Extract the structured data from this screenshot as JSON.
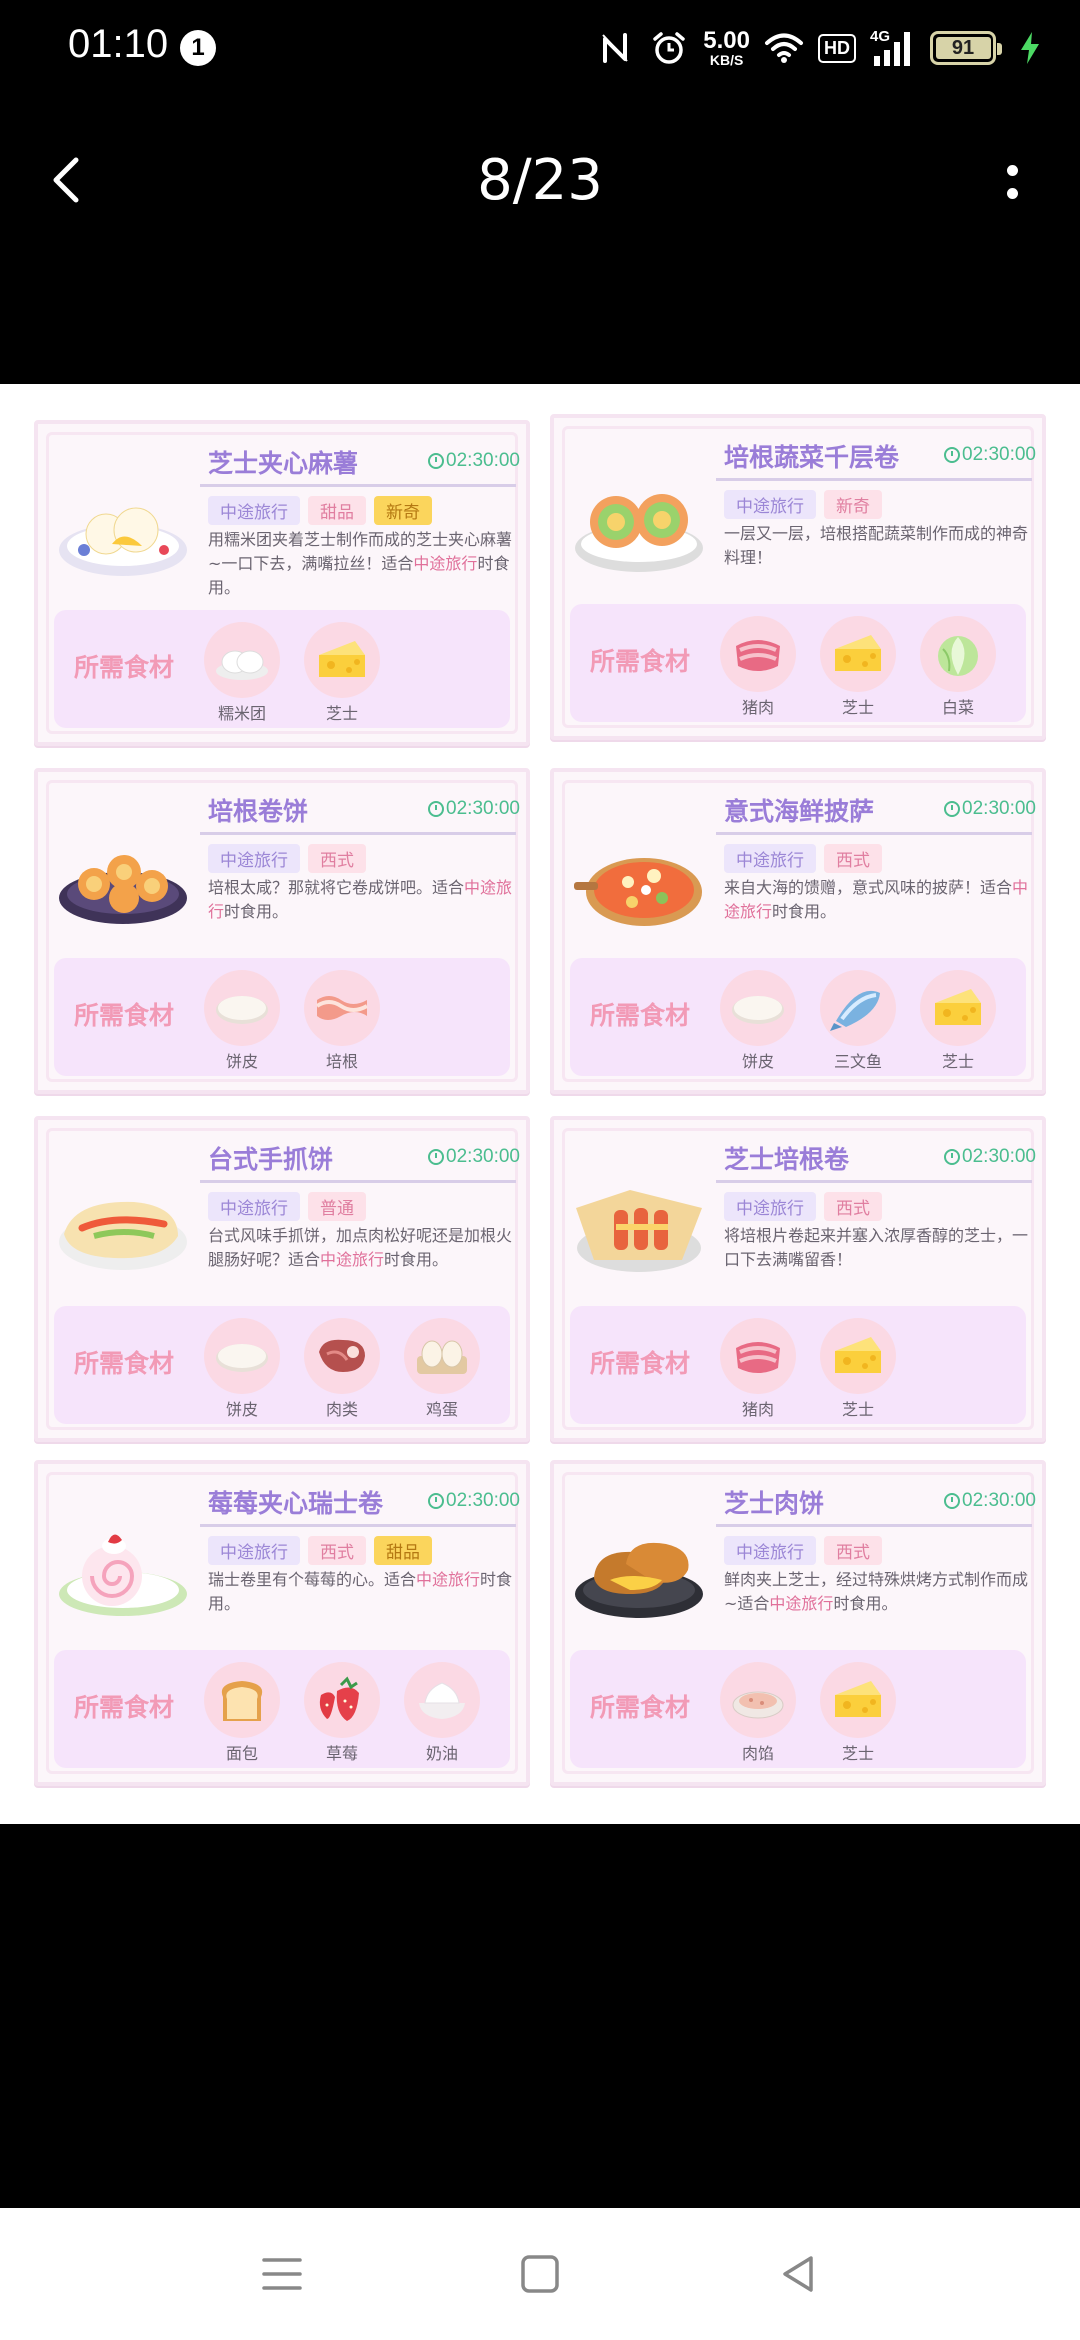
{
  "status_bar": {
    "time": "01:10",
    "notification_count": "1",
    "net_speed_value": "5.00",
    "net_speed_unit": "KB/S",
    "hd_label": "HD",
    "network_type": "4G",
    "battery_level": "91",
    "icons": [
      "nfc-icon",
      "alarm-icon",
      "wifi-icon",
      "hd-icon",
      "signal-icon",
      "battery-icon",
      "charging-icon"
    ]
  },
  "app_bar": {
    "page_counter": "8/23",
    "back_icon": "chevron-left-icon",
    "more_icon": "more-vertical-icon"
  },
  "ingredients_label": "所需食材",
  "cards": [
    {
      "title": "芝士夹心麻薯",
      "time": "02:30:00",
      "tags": [
        {
          "text": "中途旅行",
          "style": "lav"
        },
        {
          "text": "甜品",
          "style": "pink"
        },
        {
          "text": "新奇",
          "style": "yel"
        }
      ],
      "desc_parts": [
        "用糯米团夹着芝士制作而成的芝士夹心麻薯~一口下去，满嘴拉丝！适合",
        "中途旅行",
        "时食用。"
      ],
      "ingredients": [
        {
          "name": "糯米团",
          "icon": "rice-ball-icon"
        },
        {
          "name": "芝士",
          "icon": "cheese-icon"
        }
      ]
    },
    {
      "title": "培根蔬菜千层卷",
      "time": "02:30:00",
      "tags": [
        {
          "text": "中途旅行",
          "style": "lav"
        },
        {
          "text": "新奇",
          "style": "pink"
        }
      ],
      "desc_parts": [
        "一层又一层，培根搭配蔬菜制作而成的神奇料理！",
        "",
        ""
      ],
      "ingredients": [
        {
          "name": "猪肉",
          "icon": "pork-icon"
        },
        {
          "name": "芝士",
          "icon": "cheese-icon"
        },
        {
          "name": "白菜",
          "icon": "cabbage-icon"
        }
      ]
    },
    {
      "title": "培根卷饼",
      "time": "02:30:00",
      "tags": [
        {
          "text": "中途旅行",
          "style": "lav"
        },
        {
          "text": "西式",
          "style": "pink"
        }
      ],
      "desc_parts": [
        "培根太咸？那就将它卷成饼吧。适合",
        "中途旅行",
        "时食用。"
      ],
      "ingredients": [
        {
          "name": "饼皮",
          "icon": "dough-icon"
        },
        {
          "name": "培根",
          "icon": "bacon-icon"
        }
      ]
    },
    {
      "title": "意式海鲜披萨",
      "time": "02:30:00",
      "tags": [
        {
          "text": "中途旅行",
          "style": "lav"
        },
        {
          "text": "西式",
          "style": "pink"
        }
      ],
      "desc_parts": [
        "来自大海的馈赠，意式风味的披萨！适合",
        "中途旅行",
        "时食用。"
      ],
      "ingredients": [
        {
          "name": "饼皮",
          "icon": "dough-icon"
        },
        {
          "name": "三文鱼",
          "icon": "fish-icon"
        },
        {
          "name": "芝士",
          "icon": "cheese-icon"
        }
      ]
    },
    {
      "title": "台式手抓饼",
      "time": "02:30:00",
      "tags": [
        {
          "text": "中途旅行",
          "style": "lav"
        },
        {
          "text": "普通",
          "style": "pink"
        }
      ],
      "desc_parts": [
        "台式风味手抓饼，加点肉松好呢还是加根火腿肠好呢？适合",
        "中途旅行",
        "时食用。"
      ],
      "ingredients": [
        {
          "name": "饼皮",
          "icon": "dough-icon"
        },
        {
          "name": "肉类",
          "icon": "steak-icon"
        },
        {
          "name": "鸡蛋",
          "icon": "egg-icon"
        }
      ]
    },
    {
      "title": "芝士培根卷",
      "time": "02:30:00",
      "tags": [
        {
          "text": "中途旅行",
          "style": "lav"
        },
        {
          "text": "西式",
          "style": "pink"
        }
      ],
      "desc_parts": [
        "将培根片卷起来并塞入浓厚香醇的芝士，一口下去满嘴留香！",
        "",
        ""
      ],
      "ingredients": [
        {
          "name": "猪肉",
          "icon": "pork-icon"
        },
        {
          "name": "芝士",
          "icon": "cheese-icon"
        }
      ]
    },
    {
      "title": "莓莓夹心瑞士卷",
      "time": "02:30:00",
      "tags": [
        {
          "text": "中途旅行",
          "style": "lav"
        },
        {
          "text": "西式",
          "style": "pink"
        },
        {
          "text": "甜品",
          "style": "yel"
        }
      ],
      "desc_parts": [
        "瑞士卷里有个莓莓的心。适合",
        "中途旅行",
        "时食用。"
      ],
      "ingredients": [
        {
          "name": "面包",
          "icon": "bread-icon"
        },
        {
          "name": "草莓",
          "icon": "strawberry-icon"
        },
        {
          "name": "奶油",
          "icon": "cream-icon"
        }
      ]
    },
    {
      "title": "芝士肉饼",
      "time": "02:30:00",
      "tags": [
        {
          "text": "中途旅行",
          "style": "lav"
        },
        {
          "text": "西式",
          "style": "pink"
        }
      ],
      "desc_parts": [
        "鲜肉夹上芝士，经过特殊烘烤方式制作而成~适合",
        "中途旅行",
        "时食用。"
      ],
      "ingredients": [
        {
          "name": "肉馅",
          "icon": "minced-meat-icon"
        },
        {
          "name": "芝士",
          "icon": "cheese-icon"
        }
      ]
    }
  ],
  "nav_bar": {
    "icons": [
      "menu-icon",
      "home-square-icon",
      "back-triangle-icon"
    ]
  },
  "colors": {
    "title": "#9a7dd8",
    "timer": "#4bbd8f",
    "highlight": "#e0709a",
    "ingredient_label": "#f29ab6"
  }
}
